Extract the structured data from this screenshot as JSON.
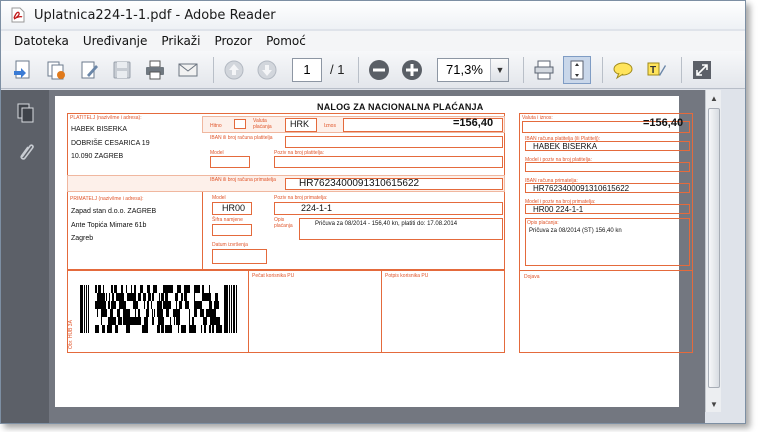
{
  "window": {
    "title": "Uplatnica224-1-1.pdf - Adobe Reader"
  },
  "menu": [
    "Datoteka",
    "Uređivanje",
    "Prikaži",
    "Prozor",
    "Pomoć"
  ],
  "toolbar": {
    "page_current": "1",
    "page_total": "/ 1",
    "zoom": "71,3%"
  },
  "form": {
    "heading": "NALOG ZA NACIONALNA PLAĆANJA",
    "payer_label": "PLATITELJ (naziv/ime i adresa):",
    "payer_lines": [
      "HABEK BISERKA",
      "DOBRIŠE CESARICA 19",
      "10.090 ZAGREB"
    ],
    "hitno_label": "Hitno",
    "currency_label": "Valuta plaćanja",
    "currency": "HRK",
    "amount_label": "Iznos",
    "amount": "=156,40",
    "iban_payer_label": "IBAN ili broj računa platitelja",
    "model_label": "Model",
    "ref_payer_label": "Poziv na broj platitelja:",
    "iban_recipient_label": "IBAN ili broj računa primatelja",
    "iban_recipient": "HR7623400091310615622",
    "recipient_label": "PRIMATELJ (naziv/ime i adresa):",
    "recipient_lines": [
      "Zapad stan d.o.o. ZAGREB",
      "Ante Topića Mimare 61b",
      "Zagreb"
    ],
    "model_value": "HR00",
    "ref_recipient_label": "Poziv na broj primatelja:",
    "ref_recipient": "224-1-1",
    "purpose_code_label": "Šifra namjene",
    "description_label": "Opis plaćanja",
    "description": "Pričuva za 08/2014 - 156,40 kn,  platiti do: 17.08.2014",
    "date_label": "Datum izvršenja",
    "stamp_label": "Pečat korisnika PU",
    "signature_label": "Potpis korisnika PU",
    "side_barcode_label": "Obr. HUB 3A",
    "receipt": {
      "amount_label": "Valuta i iznos:",
      "amount": "=156,40",
      "iban_payer_label": "IBAN računa platitelja (ili Platitelj):",
      "payer_name": "HABEK BISERKA",
      "model_ref_payer_label": "Model i poziv na broj platitelja:",
      "iban_recipient_label": "IBAN računa primatelja:",
      "iban_recipient": "HR7623400091310615622",
      "model_ref_recipient_label": "Model i poziv na broj primatelja:",
      "model_ref_recipient": "HR00   224-1-1",
      "description_label": "Opis plaćanja:",
      "description": "Pričuva za 08/2014 (ST) 156,40 kn",
      "notes_label": "Dojava"
    }
  },
  "colors": {
    "form_accent": "#e0552a",
    "doc_background": "#737780",
    "left_nav": "#5c6068"
  }
}
